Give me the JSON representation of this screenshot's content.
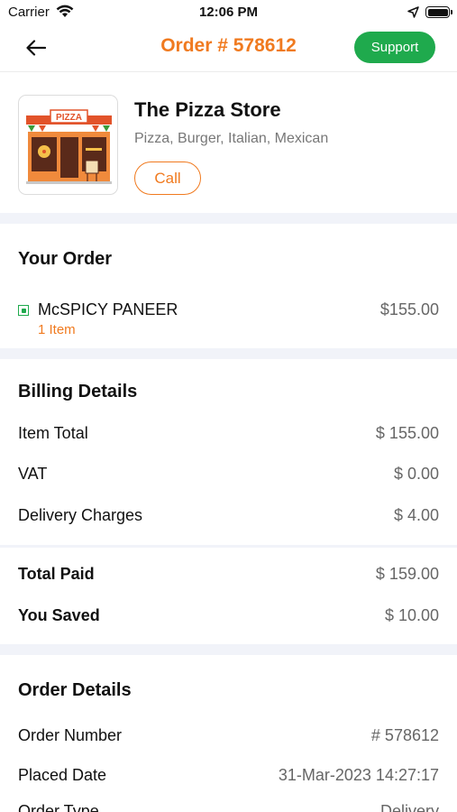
{
  "status_bar": {
    "carrier": "Carrier",
    "time": "12:06 PM"
  },
  "header": {
    "title": "Order # 578612",
    "support_label": "Support"
  },
  "store": {
    "sign_text": "PIZZA",
    "name": "The Pizza Store",
    "cuisines": "Pizza, Burger, Italian, Mexican",
    "call_label": "Call"
  },
  "your_order": {
    "title": "Your Order",
    "items": [
      {
        "name": "McSPICY PANEER",
        "quantity": "1 Item",
        "price": "$155.00"
      }
    ]
  },
  "billing": {
    "title": "Billing Details",
    "rows": [
      {
        "label": "Item Total",
        "value": "$ 155.00"
      },
      {
        "label": "VAT",
        "value": "$ 0.00"
      },
      {
        "label": "Delivery Charges",
        "value": "$ 4.00"
      }
    ],
    "totals": [
      {
        "label": "Total Paid",
        "value": "$ 159.00"
      },
      {
        "label": "You Saved",
        "value": "$ 10.00"
      }
    ]
  },
  "order_details": {
    "title": "Order Details",
    "rows": [
      {
        "label": "Order Number",
        "value": "# 578612"
      },
      {
        "label": "Placed Date",
        "value": "31-Mar-2023 14:27:17"
      },
      {
        "label": "Order Type",
        "value": "Delivery"
      }
    ]
  },
  "colors": {
    "accent": "#f07a1f",
    "support_green": "#1faa4d",
    "divider": "#f1f3f9"
  },
  "icons": [
    "wifi-icon",
    "back-arrow-icon",
    "location-arrow-icon",
    "battery-icon",
    "veg-indicator-icon"
  ]
}
